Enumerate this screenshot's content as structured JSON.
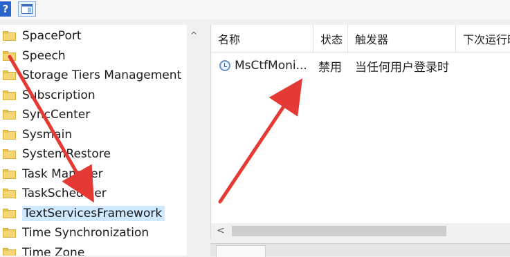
{
  "toolbar": {
    "help_glyph": "?",
    "help_icon": "help-icon",
    "view_icon": "show-hide-pane-icon"
  },
  "tree": {
    "items": [
      {
        "label": "SpacePort"
      },
      {
        "label": "Speech"
      },
      {
        "label": "Storage Tiers Management"
      },
      {
        "label": "Subscription"
      },
      {
        "label": "SyncCenter"
      },
      {
        "label": "Sysmain"
      },
      {
        "label": "SystemRestore"
      },
      {
        "label": "Task Manager"
      },
      {
        "label": "TaskScheduler"
      },
      {
        "label": "TextServicesFramework",
        "selected": true
      },
      {
        "label": "Time Synchronization"
      },
      {
        "label": "Time Zone"
      }
    ],
    "scroll_up_glyph": "^"
  },
  "list": {
    "columns": [
      "名称",
      "状态",
      "触发器",
      "下次运行时"
    ],
    "rows": [
      {
        "name": "MsCtfMoni...",
        "status": "禁用",
        "trigger": "当任何用户登录时",
        "icon": "task-clock-icon"
      }
    ],
    "hscroll_left_glyph": "<"
  },
  "annotation": {
    "arrow_color": "#e53935"
  }
}
